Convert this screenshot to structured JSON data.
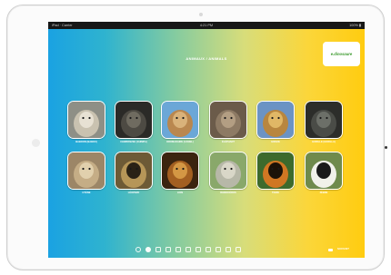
{
  "status_bar": {
    "carrier": "iPad · Carrier",
    "time": "4:21 PM",
    "battery": "100% ▮"
  },
  "page": {
    "title": "ANIMAUX / ANIMALS"
  },
  "logo": {
    "text": "e.dinosaure"
  },
  "animals": [
    {
      "label": "BABOON (BABOU)",
      "icon": "baboon-photo",
      "colors": [
        "#8e8f86",
        "#c9c2b0",
        "#e7e1d3"
      ]
    },
    {
      "label": "CHIMPANZEE (CHIMPA)",
      "icon": "chimpanzee-photo",
      "colors": [
        "#2b2a27",
        "#4d4a43",
        "#6f6b60"
      ]
    },
    {
      "label": "DROMADAIRE (CAMEL)",
      "icon": "camel-photo",
      "colors": [
        "#6ba7d7",
        "#b9874f",
        "#d9b27a"
      ]
    },
    {
      "label": "ÉLÉPHANT",
      "icon": "elephant-photo",
      "colors": [
        "#6b5b4a",
        "#8d7a64",
        "#b39e83"
      ]
    },
    {
      "label": "GIRAFE",
      "icon": "giraffe-photo",
      "colors": [
        "#6b93c4",
        "#b8863f",
        "#e0b766"
      ]
    },
    {
      "label": "GORILLE (GORILLA)",
      "icon": "gorilla-photo",
      "colors": [
        "#2c2d2a",
        "#4a4c47",
        "#6c6f68"
      ]
    },
    {
      "label": "HYÈNE",
      "icon": "hyena-photo",
      "colors": [
        "#9c8667",
        "#c5ad86",
        "#e1d0ad"
      ]
    },
    {
      "label": "LÉOPARD",
      "icon": "leopard-photo",
      "colors": [
        "#6d5a36",
        "#b69658",
        "#2a2216"
      ]
    },
    {
      "label": "LION",
      "icon": "lion-photo",
      "colors": [
        "#3b2410",
        "#a35f21",
        "#d49744"
      ]
    },
    {
      "label": "RHINOCÉROS",
      "icon": "rhinoceros-photo",
      "colors": [
        "#89a86a",
        "#b7b8a8",
        "#d9d7c8"
      ]
    },
    {
      "label": "TIGRE",
      "icon": "tiger-photo",
      "colors": [
        "#3d6a2c",
        "#d07723",
        "#1b1208"
      ]
    },
    {
      "label": "ZÈBRE",
      "icon": "zebra-photo",
      "colors": [
        "#6f8a4c",
        "#f1f1ea",
        "#1a1a1a"
      ]
    }
  ],
  "pager": {
    "pages": 11,
    "active_index": 1
  },
  "navigation": {
    "next_label": "SUIVANT"
  },
  "colors": {
    "gradient_left": "#1aa2e2",
    "gradient_right": "#ffcc10",
    "status_bar": "#171717",
    "logo_green": "#3b9a2d"
  }
}
